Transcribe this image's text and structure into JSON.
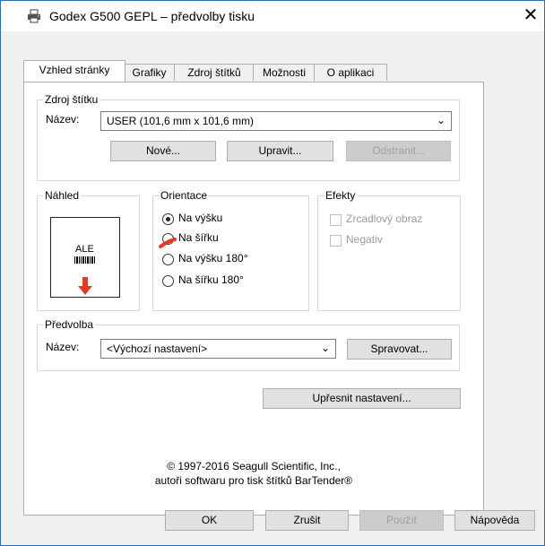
{
  "window": {
    "title": "Godex G500 GEPL – předvolby tisku",
    "close_glyph": "✕"
  },
  "tabs": [
    {
      "label": "Vzhled stránky",
      "active": true
    },
    {
      "label": "Grafiky"
    },
    {
      "label": "Zdroj štítků"
    },
    {
      "label": "Možnosti"
    },
    {
      "label": "O aplikaci"
    }
  ],
  "label_source": {
    "group_label": "Zdroj štítku",
    "name_label": "Název:",
    "selected": "USER (101,6 mm x 101,6 mm)",
    "new_button": "Nové...",
    "edit_button": "Upravit...",
    "delete_button": "Odstranit..."
  },
  "preview": {
    "group_label": "Náhled",
    "sample_text": "ALE",
    "arrow_color": "#e03c28"
  },
  "orientation": {
    "group_label": "Orientace",
    "options": [
      "Na výšku",
      "Na šířku",
      "Na výšku 180°",
      "Na šířku 180°"
    ],
    "selected_index": 0
  },
  "effects": {
    "group_label": "Efekty",
    "mirror_label": "Zrcadlový obraz",
    "negative_label": "Negativ"
  },
  "preset": {
    "group_label": "Předvolba",
    "name_label": "Název:",
    "selected": "<Výchozí nastavení>",
    "manage_button": "Spravovat..."
  },
  "advanced_button": "Upřesnit nastavení...",
  "copyright": {
    "line1": "© 1997-2016 Seagull Scientific, Inc.,",
    "line2": "autoři softwaru pro tisk štítků BarTender®"
  },
  "footer": {
    "ok": "OK",
    "cancel": "Zrušit",
    "apply": "Použít",
    "help": "Nápověda"
  }
}
